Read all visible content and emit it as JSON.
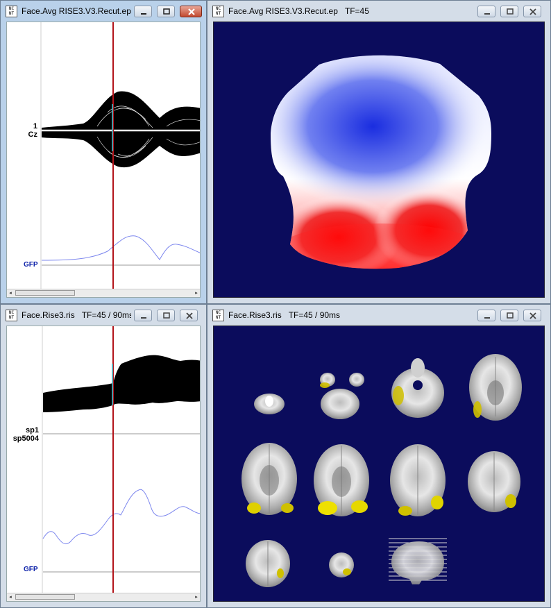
{
  "windows": {
    "top_left": {
      "title": "Face.Avg RISE3.V3.Recut.ep ...",
      "track_label_1": "1",
      "track_label_2": "Cz",
      "gfp_label": "GFP"
    },
    "top_right": {
      "title": "Face.Avg RISE3.V3.Recut.ep",
      "tf": "TF=45"
    },
    "bottom_left": {
      "title": "Face.Rise3.ris",
      "tf": "TF=45 / 90ms...",
      "track_label_1": "sp1",
      "track_label_2": "sp5004",
      "gfp_label": "GFP"
    },
    "bottom_right": {
      "title": "Face.Rise3.ris",
      "tf": "TF=45 / 90ms"
    }
  },
  "colors": {
    "accent_cursor": "#b3141a",
    "gfp_line": "#7d87ee",
    "map_background": "#0b0c5c",
    "positive": "#ff0000",
    "negative": "#1a2de0"
  },
  "icons": {
    "app": "app-icon",
    "minimize": "minimize-icon",
    "maximize": "maximize-icon",
    "close": "close-icon"
  }
}
